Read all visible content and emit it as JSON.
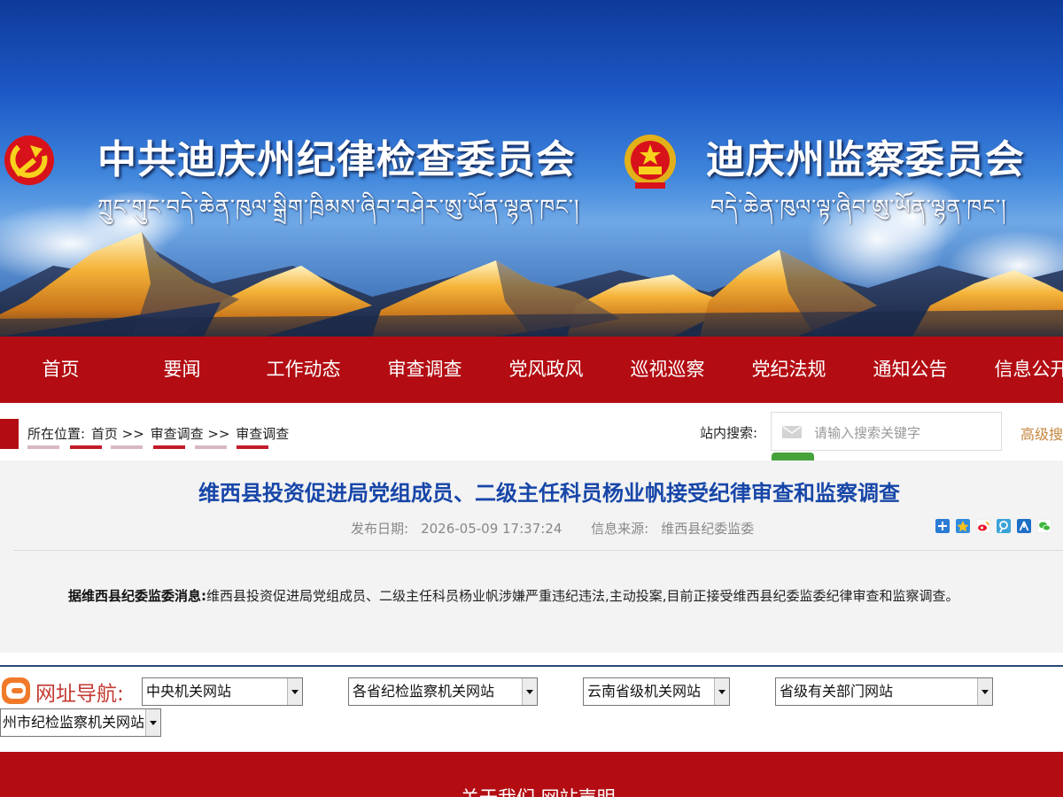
{
  "banner": {
    "title_left": "中共迪庆州纪律检查委员会",
    "title_right": "迪庆州监察委员会",
    "tibetan_left": "ཀྲུང་གུང་བདེ་ཆེན་ཁུལ་སྒྲིག་ཁྲིམས་ཞིབ་བཤེར་ཨུ་ཡོན་ལྷན་ཁང་།",
    "tibetan_right": "བདེ་ཆེན་ཁུལ་ལྟ་ཞིབ་ཨུ་ཡོན་ལྷན་ཁང་།"
  },
  "nav": {
    "items": [
      "首页",
      "要闻",
      "工作动态",
      "审查调查",
      "党风政风",
      "巡视巡察",
      "党纪法规",
      "通知公告",
      "信息公开"
    ]
  },
  "breadcrumb": {
    "prefix": "所在位置:",
    "items": [
      "首页",
      "审查调查",
      "审查调查"
    ],
    "separator": ">>"
  },
  "search": {
    "label": "站内搜索:",
    "placeholder": "请输入搜索关键字",
    "advanced": "高级搜索"
  },
  "article": {
    "title": "维西县投资促进局党组成员、二级主任科员杨业帆接受纪律审查和监察调查",
    "publish_label": "发布日期:",
    "publish_date": "2026-05-09 17:37:24",
    "source_label": "信息来源:",
    "source": "维西县纪委监委",
    "lead": "据维西县纪委监委消息:",
    "body": "维西县投资促进局党组成员、二级主任科员杨业帆涉嫌严重违纪违法,主动投案,目前正接受维西县纪委监委纪律审查和监察调查。"
  },
  "share_icons": [
    "share-more-icon",
    "qzone-icon",
    "weibo-icon",
    "tencent-weibo-icon",
    "renren-icon",
    "wechat-icon"
  ],
  "link_nav": {
    "label": "网址导航:",
    "selects": [
      "中央机关网站",
      "各省纪检监察机关网站",
      "云南省级机关网站",
      "省级有关部门网站",
      "州市纪检监察机关网站"
    ]
  },
  "footer": {
    "links": "关于我们 网站声明"
  },
  "colors": {
    "brand_red": "#b30d13",
    "title_blue": "#1746a8",
    "advanced_orange": "#c4863e",
    "search_green": "#46a33c"
  }
}
